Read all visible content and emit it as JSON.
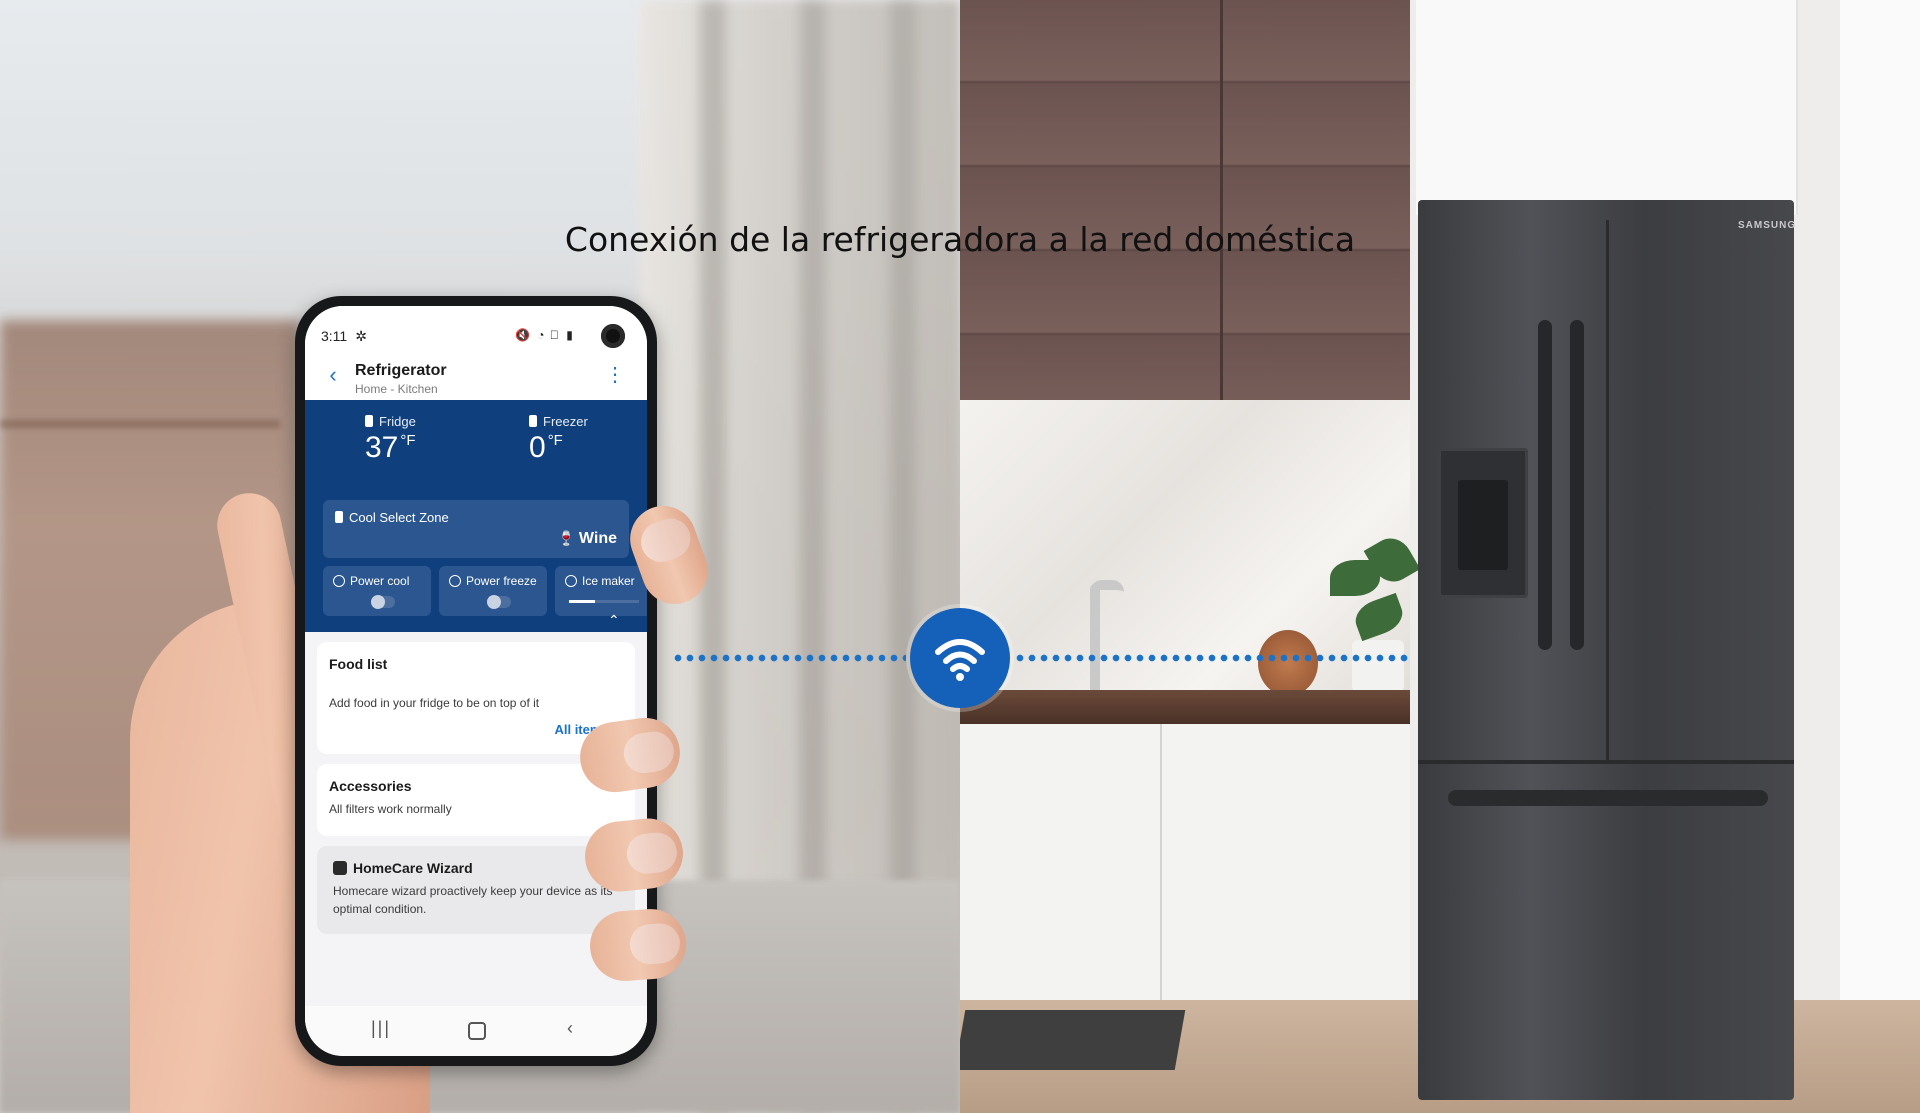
{
  "headline": "Conexión de la refrigeradora a la red doméstica",
  "fridge_brand": "SAMSUNG",
  "phone": {
    "status": {
      "time": "3:11",
      "extra_icon": "✲",
      "icons": "🔇 ◔ ⃠ ▮"
    },
    "app": {
      "title": "Refrigerator",
      "subtitle": "Home - Kitchen"
    },
    "temps": [
      {
        "label": "Fridge",
        "value": "37",
        "unit": "°F"
      },
      {
        "label": "Freezer",
        "value": "0",
        "unit": "°F"
      }
    ],
    "cool_select": {
      "label": "Cool Select Zone",
      "value": "Wine"
    },
    "features": [
      {
        "label": "Power cool"
      },
      {
        "label": "Power freeze"
      },
      {
        "label": "Ice maker"
      }
    ],
    "food_list": {
      "title": "Food list",
      "text": "Add food in your fridge to be on top of it",
      "link": "All items"
    },
    "accessories": {
      "title": "Accessories",
      "text": "All filters work normally"
    },
    "homecare": {
      "title": "HomeCare Wizard",
      "text": "Homecare wizard proactively keep your device as its optimal condition."
    }
  },
  "colors": {
    "accent": "#1a73c9",
    "panel": "#0f3f7c",
    "wifi_badge": "#1560b8"
  },
  "icons": [
    "wifi-icon",
    "back-arrow-icon",
    "more-vert-icon",
    "fridge-icon",
    "freezer-icon",
    "wine-glass-icon",
    "collapse-icon",
    "home-icon",
    "recents-icon"
  ]
}
